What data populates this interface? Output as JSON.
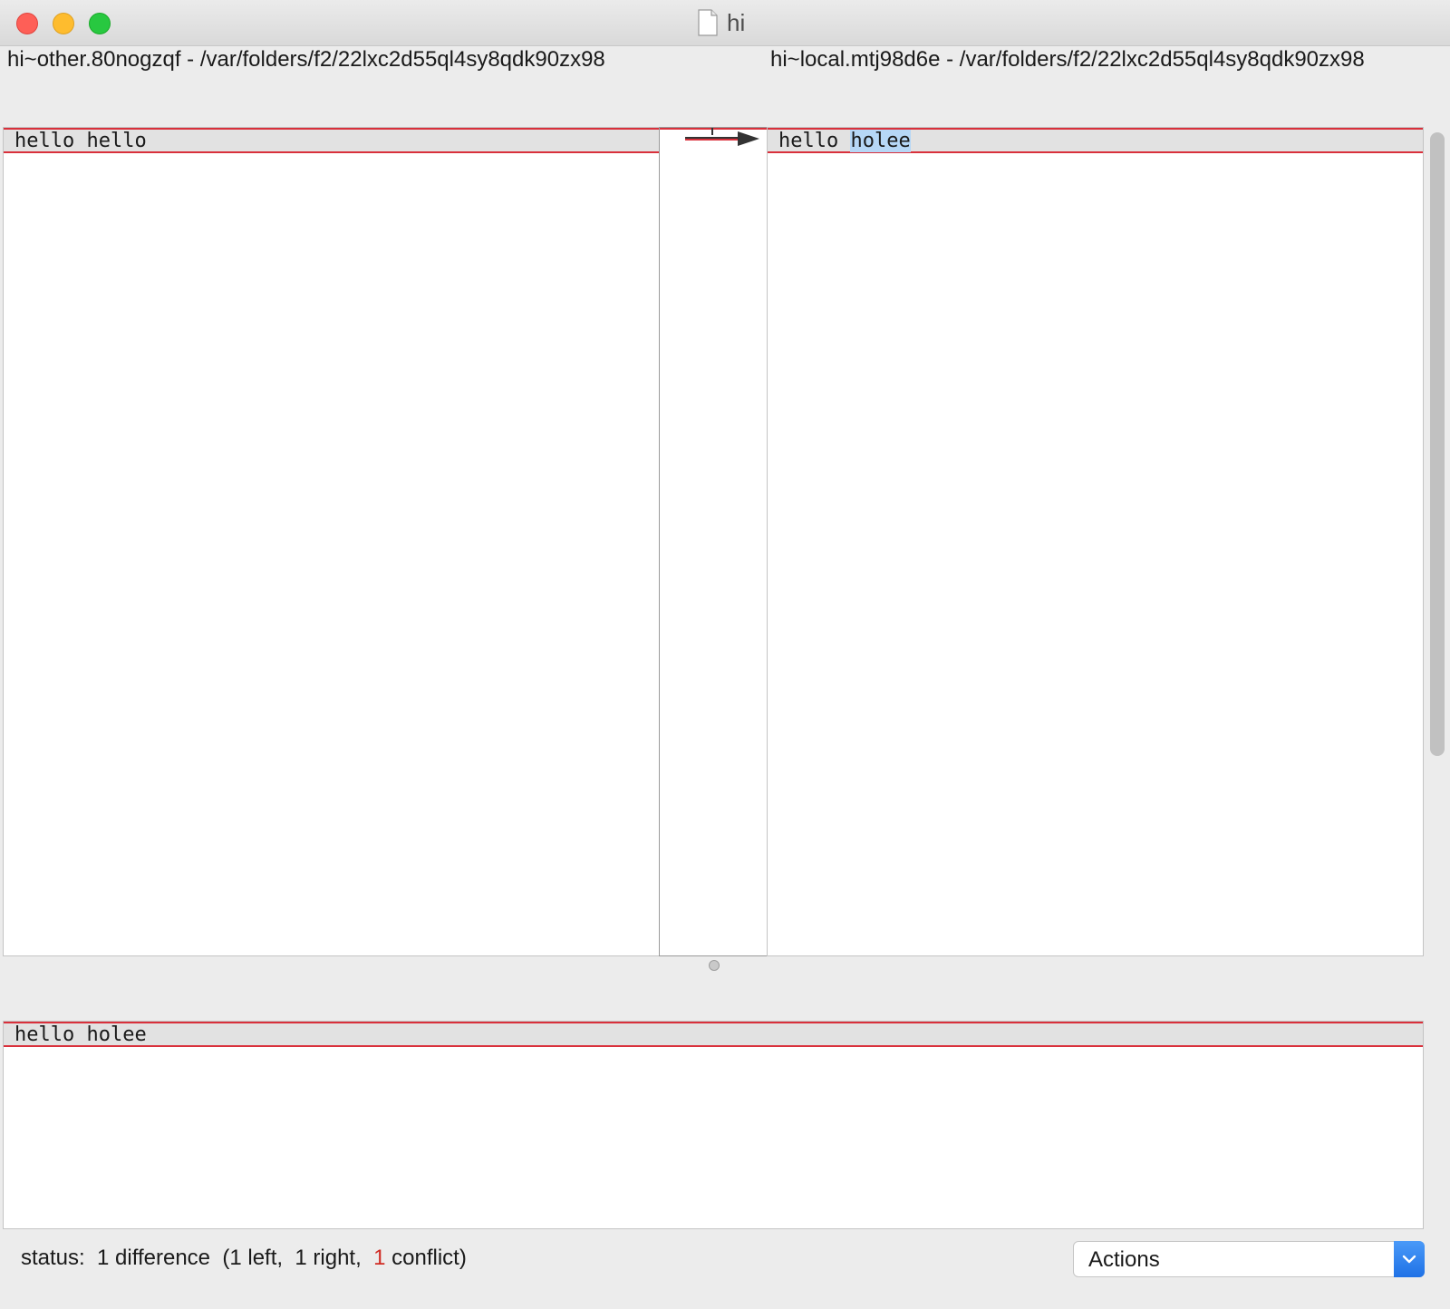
{
  "window": {
    "title": "hi",
    "icons": [
      "close-light",
      "minimize-light",
      "zoom-light",
      "document-icon"
    ]
  },
  "paths": {
    "left": "hi~other.80nogzqf - /var/folders/f2/22lxc2d55ql4sy8qdk90zx98",
    "right": "hi~local.mtj98d6e - /var/folders/f2/22lxc2d55ql4sy8qdk90zx98"
  },
  "panes": {
    "left": {
      "line_prefix": "hello ",
      "line_changed": "hello"
    },
    "right": {
      "line_prefix": "hello ",
      "line_changed": "holee"
    },
    "merged": {
      "line": "hello holee"
    }
  },
  "colors": {
    "diff_border": "#d9303b",
    "change_highlight": "#b6d7f6",
    "conflict_count": "#d02a22",
    "actions_button": "#1f72e6"
  },
  "status": {
    "prefix": "status:  1 difference  (1 left,  1 right,  ",
    "conflict_count": "1",
    "suffix": " conflict)"
  },
  "actions": {
    "selected": "Actions",
    "icon": "chevron-down-icon"
  }
}
